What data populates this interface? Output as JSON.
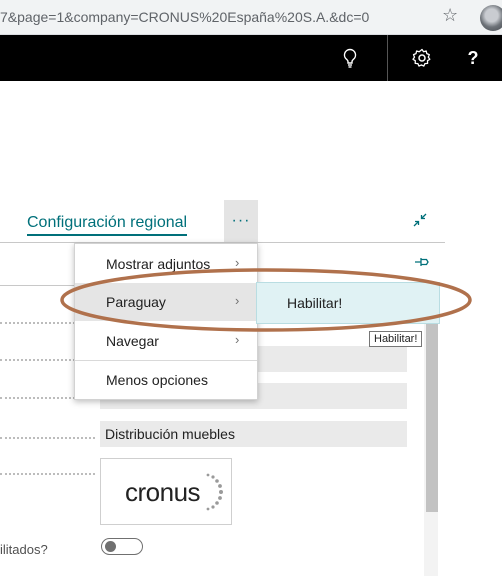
{
  "browser": {
    "url": "7&page=1&company=CRONUS%20España%20S.A.&dc=0",
    "bookmark_icon": "star-icon",
    "profile_icon": "avatar-icon"
  },
  "appbar": {
    "icons": [
      "lightbulb-icon",
      "gear-icon",
      "help-icon"
    ],
    "help_label": "?"
  },
  "page": {
    "title": "Configuración regional",
    "more_label": "···",
    "collapse_icon": "collapse-icon",
    "pin_icon": "pin-icon"
  },
  "menu": {
    "items": [
      {
        "label": "Mostrar adjuntos",
        "chevron": "›"
      },
      {
        "label": "Paraguay",
        "chevron": "›"
      },
      {
        "label": "Navegar",
        "chevron": "›"
      },
      {
        "label": "Menos opciones"
      }
    ],
    "submenu": {
      "label": "Habilitar!"
    },
    "tooltip": "Habilitar!"
  },
  "form": {
    "field_value": "Distribución muebles",
    "logo_text": "cronus",
    "truncated_label": "ilitados?",
    "toggle_on": false
  },
  "colors": {
    "accent": "#00707a",
    "annotation": "#b0714c"
  }
}
